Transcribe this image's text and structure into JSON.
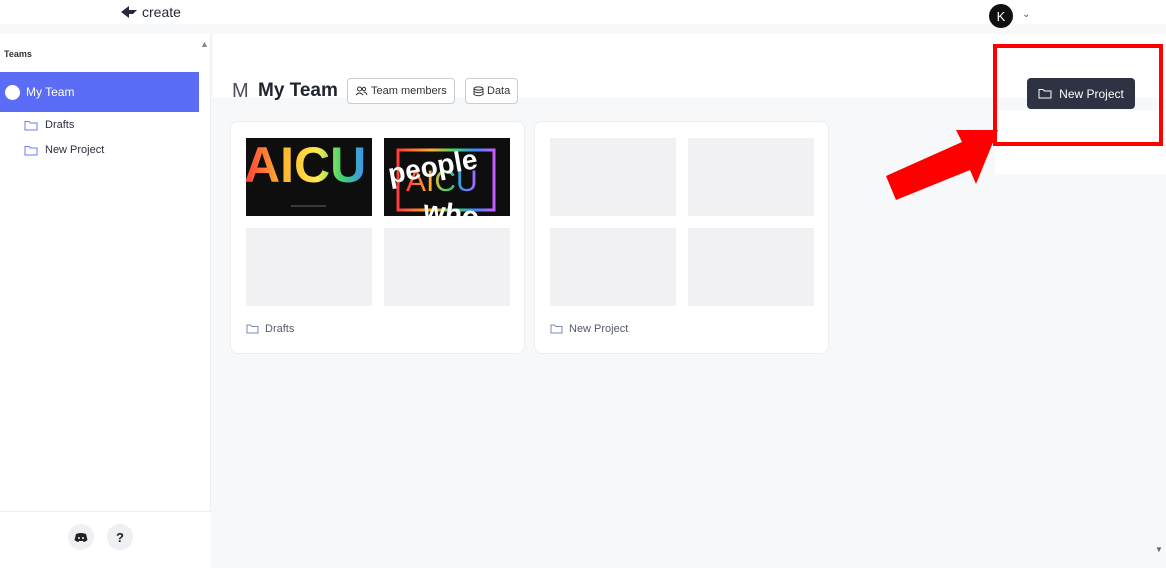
{
  "app": {
    "logo_text": "create"
  },
  "user": {
    "avatar_initial": "K"
  },
  "sidebar": {
    "heading": "Teams",
    "team": {
      "label": "My Team"
    },
    "folders": [
      {
        "label": "Drafts"
      },
      {
        "label": "New Project"
      }
    ],
    "footer": {
      "help_label": "?"
    }
  },
  "main": {
    "team_initial": "M",
    "title": "My Team",
    "team_members_label": "Team members",
    "data_label": "Data",
    "new_project_label": "New Project",
    "projects": [
      {
        "label": "Drafts",
        "thumb1_text": "AICU",
        "thumb2_word1": "people",
        "thumb2_word2": "AICU",
        "thumb2_word3": "who"
      },
      {
        "label": "New Project"
      }
    ]
  },
  "colors": {
    "accent": "#5b6cf5",
    "primary_button": "#2f3242",
    "annotation_red": "#ff0000"
  }
}
